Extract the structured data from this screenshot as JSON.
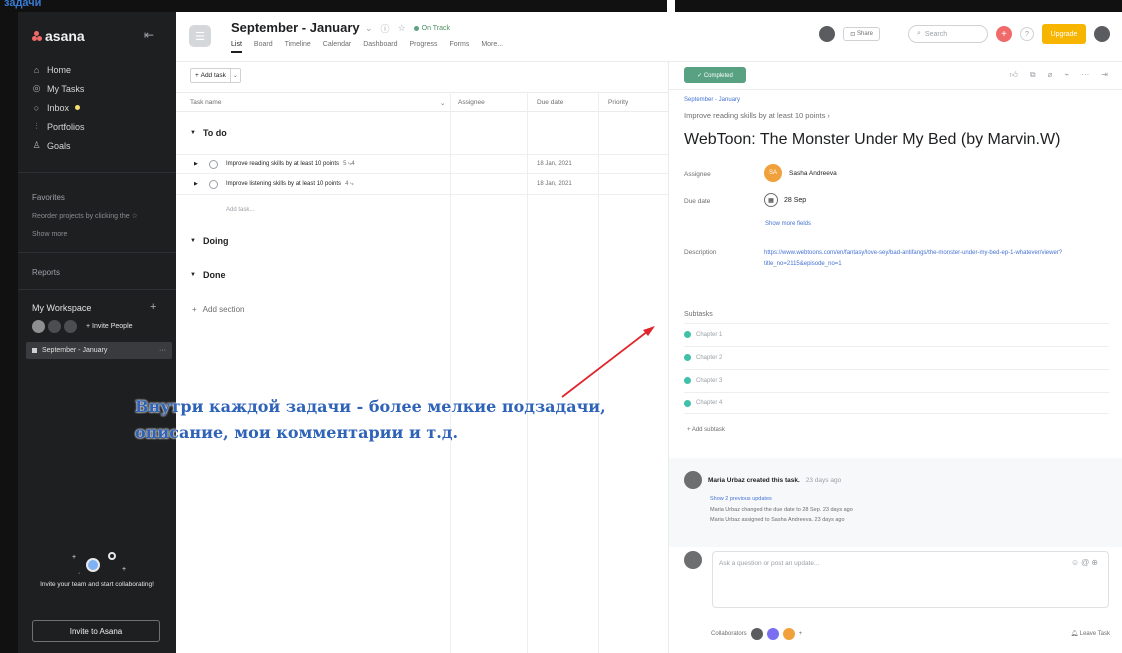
{
  "overlay": {
    "corner_word": "задачи",
    "caption_line1": "Внутри каждой задачи - более мелкие подзадачи,",
    "caption_line2": "описание, мои комментарии и т.д."
  },
  "sidebar": {
    "logo": "asana",
    "nav": [
      {
        "label": "Home",
        "icon": "home-icon"
      },
      {
        "label": "My Tasks",
        "icon": "check-circle-icon"
      },
      {
        "label": "Inbox",
        "icon": "bell-icon"
      },
      {
        "label": "Portfolios",
        "icon": "chart-icon"
      },
      {
        "label": "Goals",
        "icon": "person-icon"
      }
    ],
    "favorites_label": "Favorites",
    "favorites_hint": "Reorder projects by clicking the ☆",
    "show_more": "Show more",
    "reports_label": "Reports",
    "workspace_label": "My Workspace",
    "invite_people": "Invite People",
    "project_row": "September - January",
    "promo_text": "Invite your team and start collaborating!",
    "invite_button": "Invite to Asana"
  },
  "header": {
    "project_title": "September - January",
    "status": "On Track",
    "tabs": [
      "List",
      "Board",
      "Timeline",
      "Calendar",
      "Dashboard",
      "Progress",
      "Forms",
      "More..."
    ],
    "share": "Share",
    "search_placeholder": "Search",
    "help": "?",
    "upgrade": "Upgrade"
  },
  "list": {
    "add_task": "Add task",
    "columns": [
      "Task name",
      "Assignee",
      "Due date",
      "Priority"
    ],
    "sections": [
      {
        "name": "To do"
      },
      {
        "name": "Doing"
      },
      {
        "name": "Done"
      }
    ],
    "tasks": [
      {
        "name": "Improve reading skills by at least 10 points",
        "subtasks": "5 ⤷4",
        "due": "18 Jan, 2021"
      },
      {
        "name": "Improve listening skills by at least 10 points",
        "subtasks": "4 ⤷",
        "due": "18 Jan, 2021"
      }
    ],
    "add_row": "Add task...",
    "add_section": "Add section"
  },
  "detail": {
    "completed": "✓ Completed",
    "breadcrumb": "September - January",
    "parent_task": "Improve reading skills by at least 10 points ›",
    "title": "WebToon: The Monster Under My Bed (by Marvin.W)",
    "assignee_label": "Assignee",
    "assignee_initials": "SA",
    "assignee_name": "Sasha Andreeva",
    "due_label": "Due date",
    "due_value": "28 Sep",
    "show_more": "Show more fields",
    "description_label": "Description",
    "description": "https://www.webtoons.com/en/fantasy/love-sey/bad-antifangs/the-monster-under-my-bed-ep-1-whatever/viewer?title_no=2115&episode_no=1",
    "subtasks_label": "Subtasks",
    "subtasks": [
      "Chapter 1",
      "Chapter 2",
      "Chapter 3",
      "Chapter 4"
    ],
    "add_subtask": "+ Add subtask",
    "activity_author": "Maria Urbaz created this task.",
    "activity_time": "23 days ago",
    "activity_more": "Show 2 previous updates",
    "activity_lines": [
      "Maria Urbaz changed the due date to 28 Sep.  23 days ago",
      "Maria Urbaz assigned to Sasha Andreeva.  23 days ago"
    ],
    "comment_placeholder": "Ask a question or post an update...",
    "collaborators_label": "Collaborators",
    "leave_task": "Leave Task"
  },
  "colors": {
    "sidebar_bg": "#1e1f21",
    "completed_green": "#58a182",
    "upgrade_orange": "#f8b500",
    "subtask_teal": "#3ec1a8",
    "caption_blue": "#2f63b8",
    "arrow_red": "#e0252b"
  }
}
